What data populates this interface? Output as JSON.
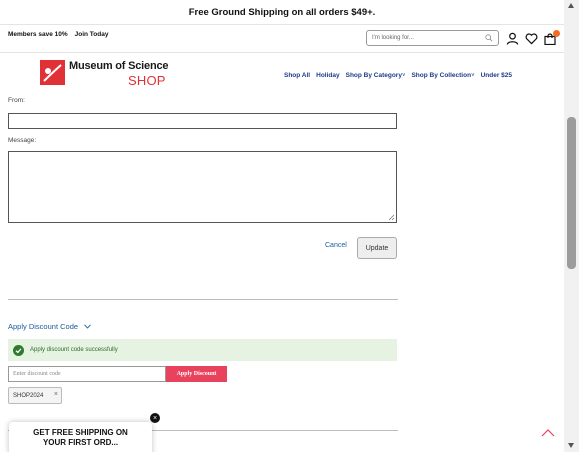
{
  "promo": {
    "text": "Free Ground Shipping on all orders $49+."
  },
  "utility": {
    "members_text": "Members save 10%",
    "join_text": "Join Today",
    "search_placeholder": "I'm looking for..."
  },
  "cart": {
    "count": ""
  },
  "logo": {
    "main": "Museum of Science",
    "sub": "SHOP"
  },
  "nav": [
    {
      "label": "Shop All"
    },
    {
      "label": "Holiday"
    },
    {
      "label": "Shop By Category",
      "chevron": true
    },
    {
      "label": "Shop By Collection",
      "chevron": true
    },
    {
      "label": "Under $25"
    }
  ],
  "form": {
    "from_label": "From:",
    "from_value": "",
    "message_label": "Message:",
    "message_value": "",
    "cancel_label": "Cancel",
    "update_label": "Update"
  },
  "discount": {
    "toggle_label": "Apply Discount Code",
    "success_message": "Apply discount code successfully",
    "input_placeholder": "Enter discount code",
    "apply_label": "Apply Discount",
    "applied_code": "SHOP2024",
    "chip_remove": "×"
  },
  "popup": {
    "line1": "GET FREE SHIPPING ON",
    "line2": "YOUR FIRST ORD...",
    "close": "×"
  },
  "colors": {
    "brand_red": "#e03236",
    "nav_blue": "#1e3a8a",
    "apply_pink": "#e8425d",
    "success_bg": "#e6f2e2",
    "success_green": "#2f6a2d",
    "cart_badge": "#f26b21"
  }
}
